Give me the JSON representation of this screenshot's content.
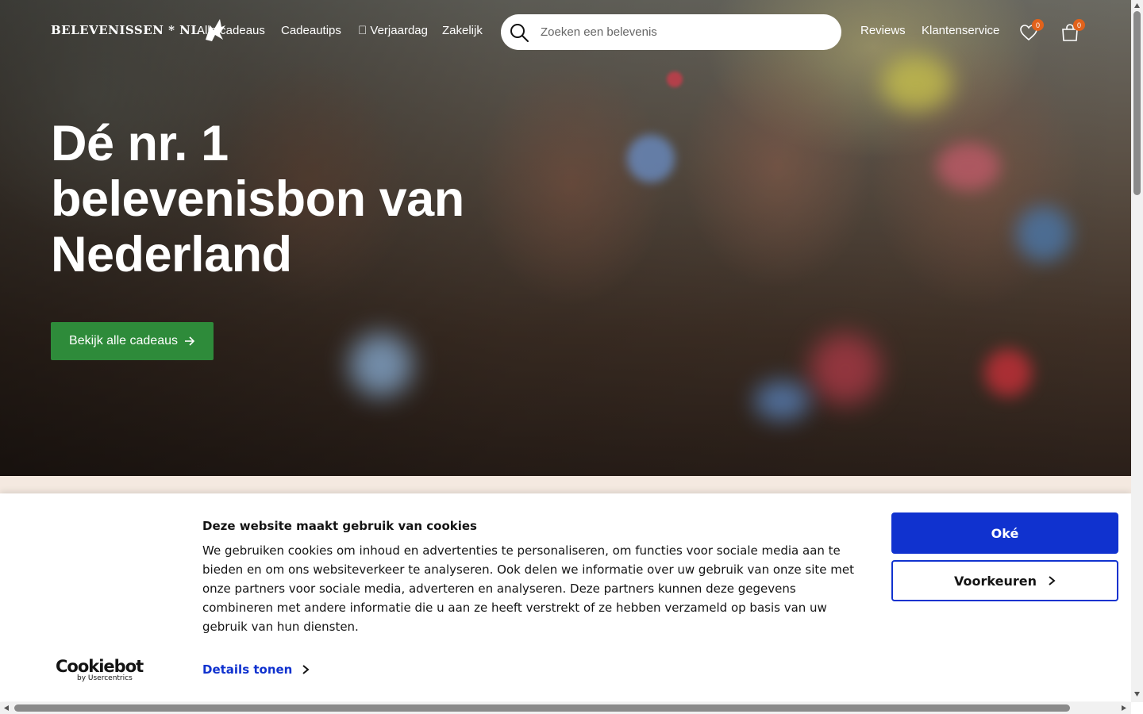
{
  "header": {
    "logo_text": "BELEVENISSEN * NL",
    "nav": [
      {
        "label": "Alle cadeaus"
      },
      {
        "label": "Cadeautips"
      },
      {
        "label": " Verjaardag"
      },
      {
        "label": "Zakelijk"
      }
    ],
    "search_placeholder": "Zoeken een belevenis",
    "right_links": [
      {
        "label": "Reviews"
      },
      {
        "label": "Klantenservice"
      }
    ],
    "wishlist_count": "0",
    "cart_count": "0",
    "accent_badge_color": "#e2621b"
  },
  "hero": {
    "title": "Dé nr. 1 belevenisbon van Nederland",
    "cta_label": "Bekijk alle cadeaus",
    "cta_color": "#2e8b3a"
  },
  "cookie": {
    "title": "Deze website maakt gebruik van cookies",
    "text": "We gebruiken cookies om inhoud en advertenties te personaliseren, om functies voor sociale media aan te bieden en om ons websiteverkeer te analyseren. Ook delen we informatie over uw gebruik van onze site met onze partners voor sociale media, adverteren en analyseren. Deze partners kunnen deze gegevens combineren met andere informatie die u aan ze heeft verstrekt of ze hebben verzameld op basis van uw gebruik van hun diensten.",
    "details_label": "Details tonen",
    "ok_label": "Oké",
    "preferences_label": "Voorkeuren",
    "brand": "Cookiebot",
    "brand_sub": "by Usercentrics",
    "accent_color": "#1032cf"
  }
}
